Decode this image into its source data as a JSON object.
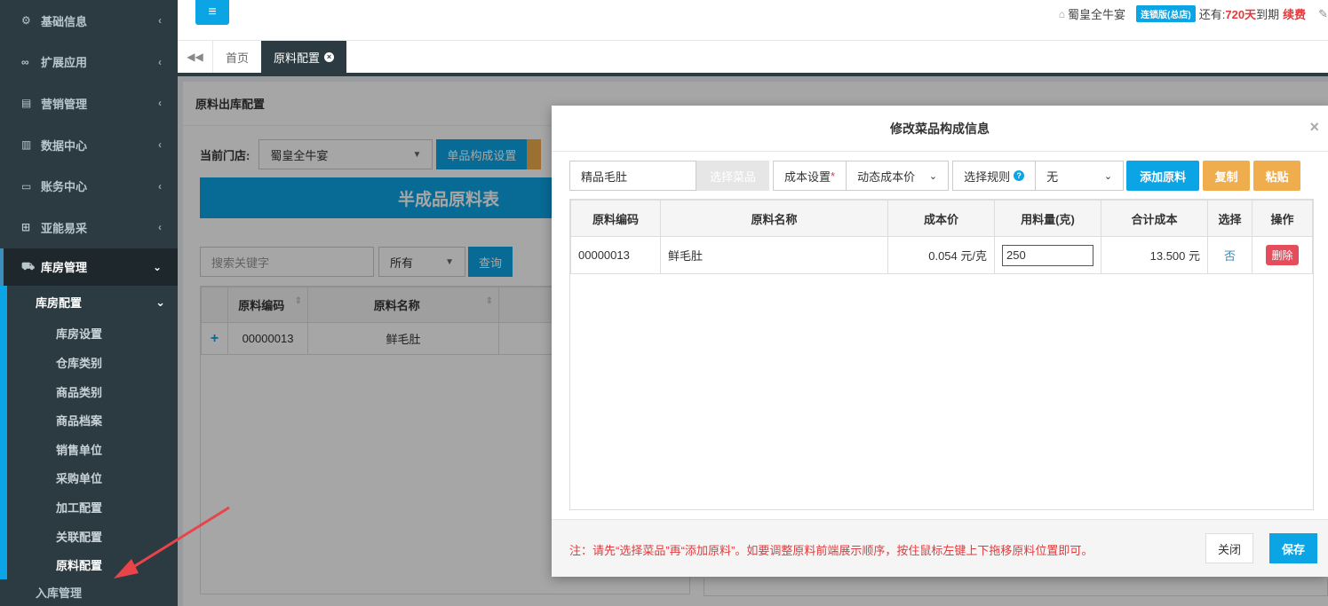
{
  "sidebar": {
    "items": [
      {
        "label": "基础信息"
      },
      {
        "label": "扩展应用"
      },
      {
        "label": "营销管理"
      },
      {
        "label": "数据中心"
      },
      {
        "label": "账务中心"
      },
      {
        "label": "亚能易采"
      },
      {
        "label": "库房管理"
      }
    ],
    "sub_head": "库房配置",
    "sub_items": [
      "库房设置",
      "仓库类别",
      "商品类别",
      "商品档案",
      "销售单位",
      "采购单位",
      "加工配置",
      "关联配置",
      "原料配置"
    ],
    "cut_item": "入库管理"
  },
  "topbar": {
    "store": "蜀皇全牛宴",
    "badge": "连锁版(总店)",
    "remain_prefix": "还有:",
    "days": "720天",
    "expire": "到期",
    "renew": "续费"
  },
  "tabs": {
    "home": "首页",
    "current": "原料配置"
  },
  "main": {
    "panel_title": "原料出库配置",
    "store_label": "当前门店:",
    "store_value": "蜀皇全牛宴",
    "single_btn": "单品构成设置",
    "banner": "半成品原料表",
    "search_placeholder": "搜索关键字",
    "filter_value": "所有",
    "query_btn": "查询",
    "grid": {
      "headers": [
        "原料编码",
        "原料名称"
      ],
      "row": {
        "code": "00000013",
        "name": "鲜毛肚"
      }
    }
  },
  "modal": {
    "title": "修改菜品构成信息",
    "dish_name": "精品毛肚",
    "select_dish_btn": "选择菜品",
    "cost_label": "成本设置",
    "cost_value": "动态成本价",
    "rule_label": "选择规则",
    "rule_value": "无",
    "add_btn": "添加原料",
    "copy_btn": "复制",
    "paste_btn": "粘贴",
    "table": {
      "headers": [
        "原料编码",
        "原料名称",
        "成本价",
        "用料量(克)",
        "合计成本",
        "选择",
        "操作"
      ],
      "rows": [
        {
          "code": "00000013",
          "name": "鲜毛肚",
          "price": "0.054 元/克",
          "qty": "250",
          "total": "13.500 元",
          "select": "否",
          "action": "删除"
        }
      ]
    },
    "note": "注：请先“选择菜品”再“添加原料”。如要调整原料前端展示顺序，按住鼠标左键上下拖移原料位置即可。",
    "close_btn": "关闭",
    "save_btn": "保存"
  }
}
